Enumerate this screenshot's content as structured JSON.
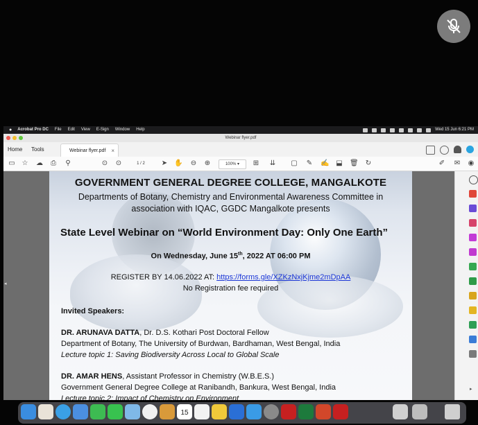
{
  "menubar": {
    "app_name": "Acrobat Pro DC",
    "items": [
      "File",
      "Edit",
      "View",
      "E-Sign",
      "Window",
      "Help"
    ],
    "clock": "Wed 15 Jun  6:21 PM"
  },
  "window": {
    "title": "Webinar flyer.pdf"
  },
  "tabs": {
    "home": "Home",
    "tools": "Tools",
    "document": "Webinar flyer.pdf"
  },
  "toolbar": {
    "page_current": "1",
    "page_total": "/ 2",
    "zoom": "100%"
  },
  "flyer": {
    "college": "GOVERNMENT GENERAL DEGREE COLLEGE, MANGALKOTE",
    "departments_line1": "Departments of Botany, Chemistry and Environmental Awareness Committee in",
    "departments_line2": "association with IQAC, GGDC Mangalkote presents",
    "webinar_title": "State Level Webinar on “World Environment Day: Only One Earth”",
    "date_prefix": "On Wednesday, June 15",
    "date_sup": "th",
    "date_suffix": ", 2022 AT 06:00 PM",
    "register_text": "REGISTER BY 14.06.2022 AT: ",
    "register_link": "https://forms.gle/XZKzNxjKjme2mDpAA",
    "no_fee": "No Registration fee required",
    "invited_heading": "Invited Speakers:",
    "speaker1_name": "DR. ARUNAVA DATTA",
    "speaker1_title": ", Dr. D.S. Kothari Post Doctoral Fellow",
    "speaker1_affil": "Department of Botany, The University of Burdwan, Bardhaman, West Bengal, India",
    "speaker1_topic": "Lecture topic 1: Saving Biodiversity Across Local to Global Scale",
    "speaker2_name": "DR. AMAR HENS",
    "speaker2_title": ", Assistant Professor in Chemistry (W.B.E.S.)",
    "speaker2_affil": "Government General Degree College at Ranibandh, Bankura, West Bengal, India",
    "speaker2_topic": "Lecture topic 2: Impact of Chemistry on Environment"
  },
  "dock": {
    "calendar_day": "15"
  },
  "colors": {
    "link": "#1a35d6",
    "acrobat_red": "#c62020"
  }
}
